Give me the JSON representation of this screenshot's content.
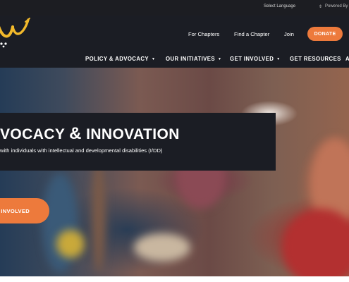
{
  "topbar": {
    "language_label": "Select Language",
    "powered_label": "Powered By"
  },
  "header": {
    "logo_icon": "brand-swoosh-logo",
    "utility_links": [
      "For Chapters",
      "Find a Chapter",
      "Join"
    ],
    "donate_label": "DONATE",
    "nav": [
      {
        "label": "POLICY & ADVOCACY",
        "dropdown": true
      },
      {
        "label": "OUR INITIATIVES",
        "dropdown": true
      },
      {
        "label": "GET INVOLVED",
        "dropdown": true
      },
      {
        "label": "GET RESOURCES",
        "dropdown": false
      },
      {
        "label": "A",
        "dropdown": false
      }
    ]
  },
  "hero": {
    "title_pre": "VOCACY ",
    "title_amp": "&",
    "title_post": " INNOVATION",
    "subtitle": "with individuals with intellectual and developmental disabilities (I/DD)",
    "cta_label": "INVOLVED"
  },
  "colors": {
    "accent": "#ed7a3c",
    "header_bg": "#1b1d24",
    "topbar_bg": "#1c1d22",
    "logo_yellow": "#f2b92b"
  }
}
